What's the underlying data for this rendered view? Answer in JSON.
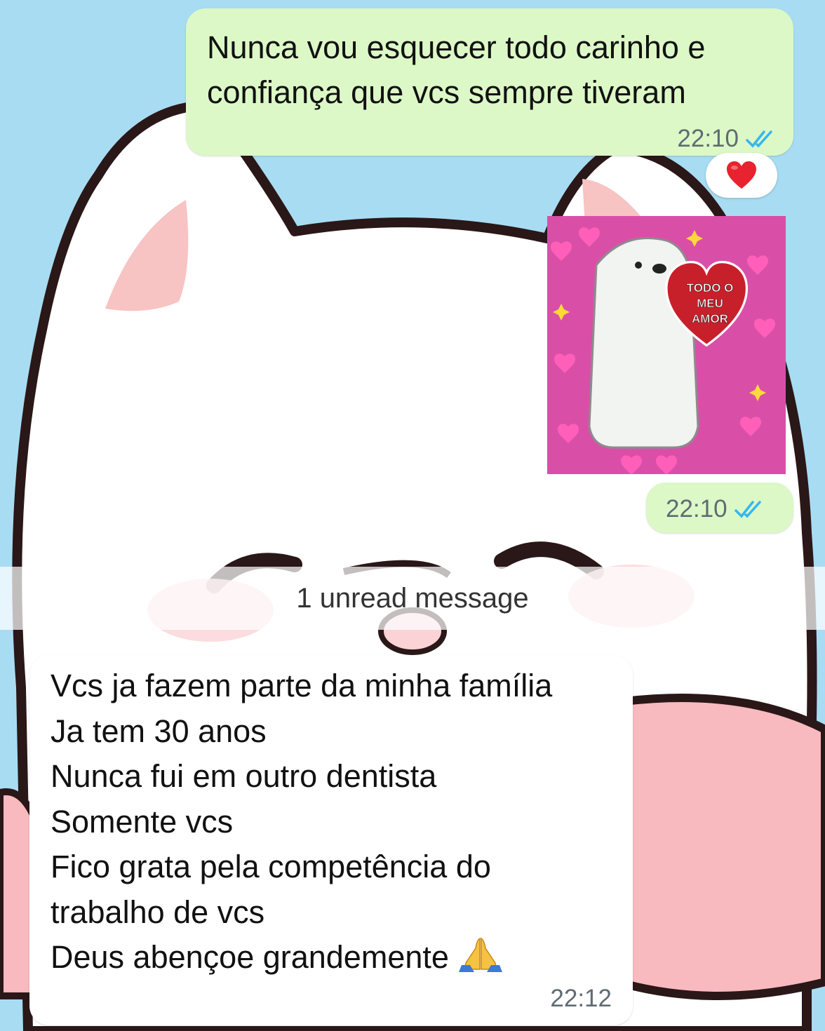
{
  "messages": [
    {
      "direction": "outgoing",
      "text_lines": [
        "Nunca vou esquecer todo carinho e",
        "confiança que vcs sempre tiveram"
      ],
      "time": "22:10",
      "status": "read",
      "reaction_icon": "red-heart-icon"
    },
    {
      "direction": "outgoing",
      "type": "sticker",
      "sticker_text": [
        "TODO O",
        "MEU",
        "AMOR"
      ],
      "time": "22:10",
      "status": "read"
    },
    {
      "direction": "incoming",
      "text_lines": [
        "Vcs ja fazem parte da minha família",
        "Ja tem 30 anos",
        "Nunca fui em outro dentista",
        "Somente vcs",
        "Fico grata pela competência do",
        "trabalho de vcs",
        "Deus abençoe grandemente"
      ],
      "trailing_icon": "folded-hands-icon",
      "time": "22:12"
    }
  ],
  "unread_divider": "1 unread message",
  "colors": {
    "outgoing_bubble": "#dcf8c6",
    "incoming_bubble": "#ffffff",
    "read_ticks": "#34b7f1",
    "wallpaper": "#a8dcf2"
  }
}
